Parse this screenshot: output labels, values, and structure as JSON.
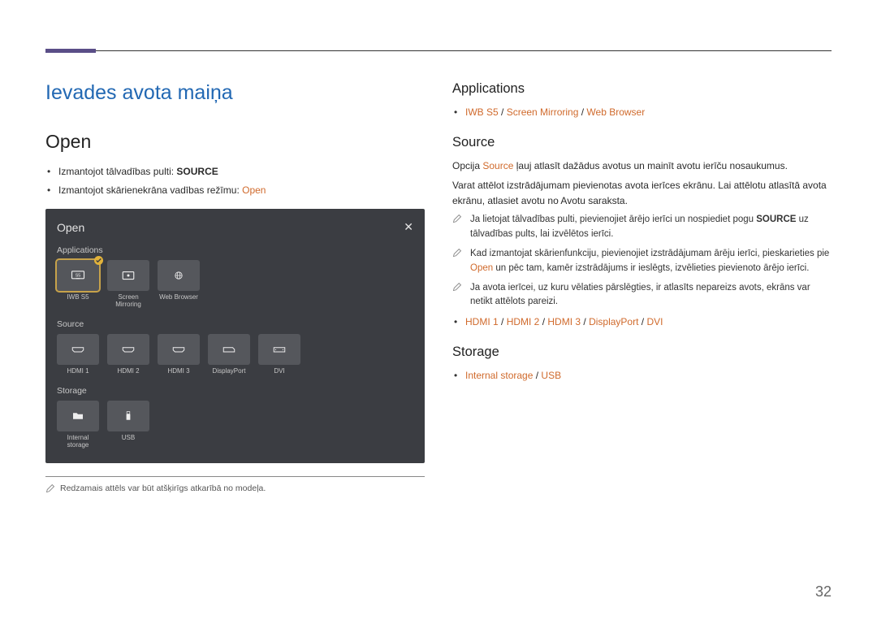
{
  "page_number": "32",
  "title": "Ievades avota maiņa",
  "left": {
    "h2": "Open",
    "b1_pre": "Izmantojot tālvadības pulti: ",
    "b1_bold": "SOURCE",
    "b2_pre": "Izmantojot skārienekrāna vadības režīmu: ",
    "b2_orange": "Open",
    "panel": {
      "title": "Open",
      "lbl_apps": "Applications",
      "apps": [
        "IWB S5",
        "Screen Mirroring",
        "Web Browser"
      ],
      "lbl_src": "Source",
      "src": [
        "HDMI 1",
        "HDMI 2",
        "HDMI 3",
        "DisplayPort",
        "DVI"
      ],
      "lbl_sto": "Storage",
      "sto": [
        "Internal storage",
        "USB"
      ]
    },
    "footnote": "Redzamais attēls var būt atšķirīgs atkarībā no modeļa."
  },
  "right": {
    "applications": {
      "h": "Applications",
      "line_parts": [
        "IWB S5",
        " / ",
        "Screen Mirroring",
        " / ",
        "Web Browser"
      ]
    },
    "source": {
      "h": "Source",
      "p1_a": "Opcija ",
      "p1_src": "Source",
      "p1_b": " ļauj atlasīt dažādus avotus un mainīt avotu ierīču nosaukumus.",
      "p2": "Varat attēlot izstrādājumam pievienotas avota ierīces ekrānu. Lai attēlotu atlasītā avota ekrānu, atlasiet avotu no Avotu saraksta.",
      "n1_a": "Ja lietojat tālvadības pulti, pievienojiet ārējo ierīci un nospiediet pogu ",
      "n1_bold": "SOURCE",
      "n1_b": " uz tālvadības pults, lai izvēlētos ierīci.",
      "n2_a": "Kad izmantojat skārienfunkciju, pievienojiet izstrādājumam ārēju ierīci, pieskarieties pie ",
      "n2_orange": "Open",
      "n2_b": " un pēc tam, kamēr izstrādājums ir ieslēgts, izvēlieties pievienoto ārējo ierīci.",
      "n3": "Ja avota ierīcei, uz kuru vēlaties pārslēgties, ir atlasīts nepareizs avots, ekrāns var netikt attēlots pareizi.",
      "ports": [
        "HDMI 1",
        " / ",
        "HDMI 2",
        " / ",
        "HDMI 3",
        " / ",
        "DisplayPort",
        " / ",
        "DVI"
      ]
    },
    "storage": {
      "h": "Storage",
      "line": [
        "Internal storage",
        " / ",
        "USB"
      ]
    }
  }
}
